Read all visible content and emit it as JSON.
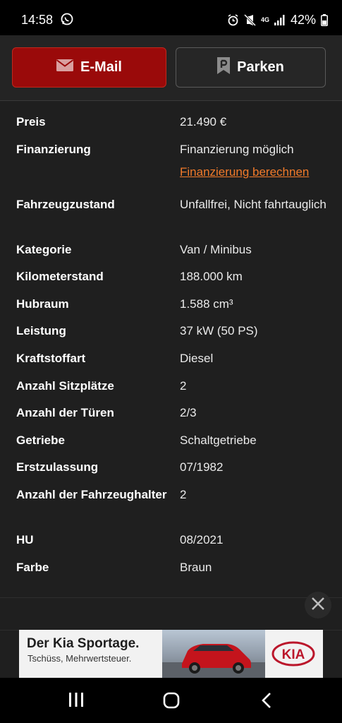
{
  "status_bar": {
    "time": "14:58",
    "network": "4G",
    "battery": "42%"
  },
  "actions": {
    "email_label": "E-Mail",
    "park_label": "Parken"
  },
  "details": [
    {
      "key": "Preis",
      "value": "21.490 €"
    },
    {
      "key": "Finanzierung",
      "value": "Finanzierung möglich",
      "link": "Finanzierung berechnen"
    },
    {
      "key": "Fahrzeugzustand",
      "value": "Unfallfrei, Nicht fahrtauglich"
    },
    {
      "key": "Kategorie",
      "value": "Van / Minibus"
    },
    {
      "key": "Kilometerstand",
      "value": "188.000 km"
    },
    {
      "key": "Hubraum",
      "value": "1.588 cm³"
    },
    {
      "key": "Leistung",
      "value": "37 kW (50 PS)"
    },
    {
      "key": "Kraftstoffart",
      "value": "Diesel"
    },
    {
      "key": "Anzahl Sitzplätze",
      "value": "2"
    },
    {
      "key": "Anzahl der Türen",
      "value": "2/3"
    },
    {
      "key": "Getriebe",
      "value": "Schaltgetriebe"
    },
    {
      "key": "Erstzulassung",
      "value": "07/1982"
    },
    {
      "key": "Anzahl der Fahrzeughalter",
      "value": "2"
    },
    {
      "key": "HU",
      "value": "08/2021"
    },
    {
      "key": "Farbe",
      "value": "Braun"
    }
  ],
  "ad": {
    "headline": "Der Kia Sportage.",
    "subline": "Tschüss, Mehrwertsteuer.",
    "brand": "KIA"
  },
  "colors": {
    "background": "#1f1f1f",
    "email_button": "#9a0a0a",
    "link": "#f07a2a"
  }
}
